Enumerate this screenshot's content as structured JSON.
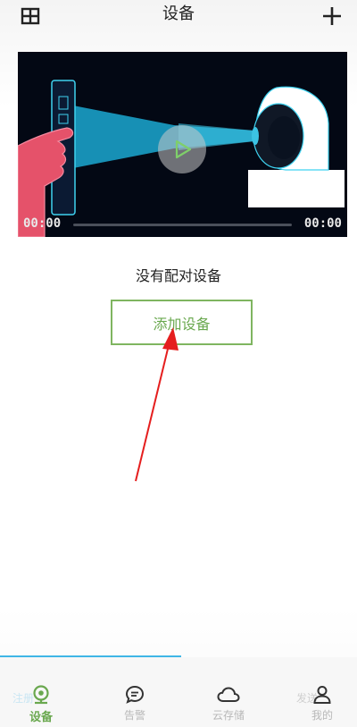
{
  "header": {
    "title": "设备",
    "menu_icon": "grid-icon",
    "add_icon": "plus-icon"
  },
  "video": {
    "current_time": "00:00",
    "total_time": "00:00",
    "progress": 0,
    "play_icon": "play-icon"
  },
  "main": {
    "empty_text": "没有配对设备",
    "add_button_label": "添加设备"
  },
  "tabs": [
    {
      "label": "设备",
      "icon": "camera-icon",
      "active": true
    },
    {
      "label": "告警",
      "icon": "chat-icon",
      "active": false
    },
    {
      "label": "云存储",
      "icon": "cloud-icon",
      "active": false
    },
    {
      "label": "我的",
      "icon": "user-icon",
      "active": false
    }
  ],
  "ghost_text": {
    "left": "注册",
    "right": "发送"
  },
  "colors": {
    "accent_green": "#6aa84f",
    "video_bg": "#030814",
    "beam_blue": "#1aa0c6",
    "hand_red": "#e5526a",
    "annotation_red": "#e51e1e",
    "loading_blue": "#3fb6e6"
  }
}
